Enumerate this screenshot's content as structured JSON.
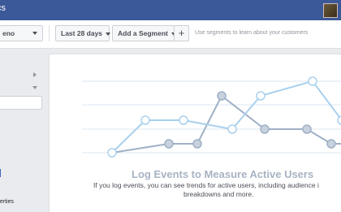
{
  "header": {
    "title": "cs"
  },
  "toolbar": {
    "app_select_value": "eno",
    "date_range_label": "Last 28 days",
    "add_segment_label": "Add a Segment",
    "plus_label": "+",
    "hint_text": "Use segments to learn about your customers"
  },
  "sidebar": {
    "bottom_label": "perties"
  },
  "empty_state": {
    "headline": "Log Events to Measure Active Users",
    "description_line1": "If you log events, you can see trends for active users, including audience i",
    "description_line2": "breakdowns and more."
  },
  "colors": {
    "header_bg": "#3b5998",
    "line_light": "#a9d1ee",
    "line_dark": "#9fb0c6"
  }
}
